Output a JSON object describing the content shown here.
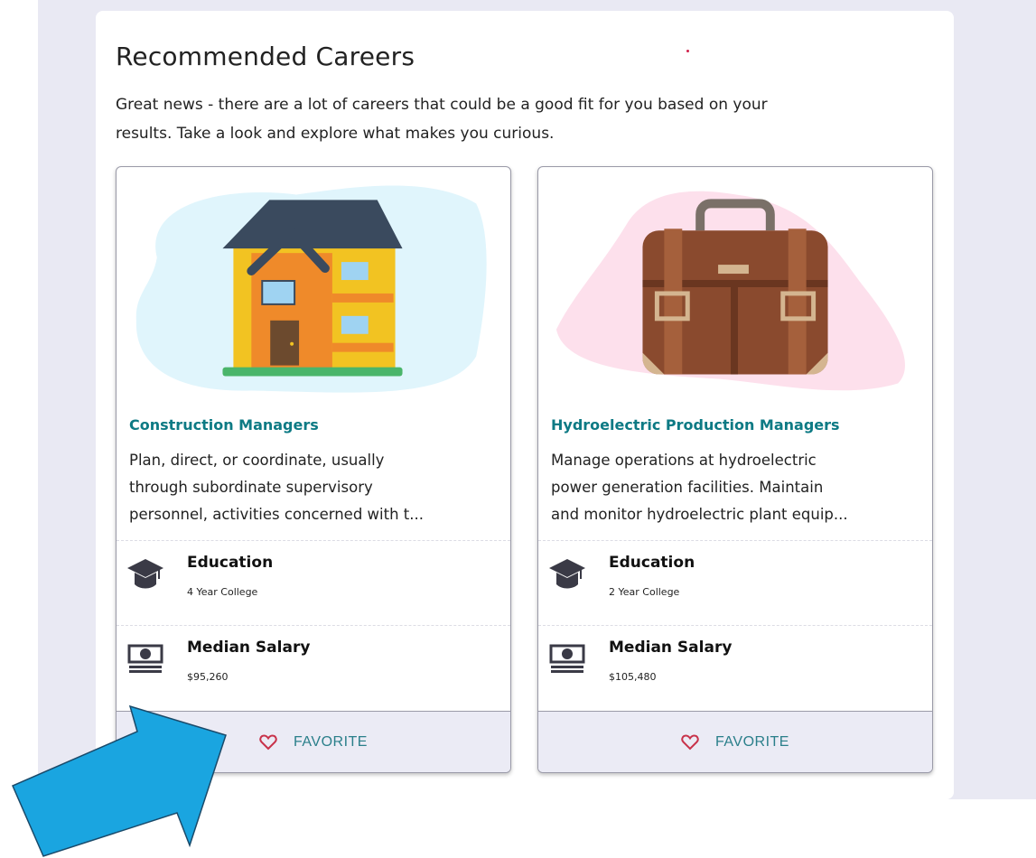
{
  "section": {
    "title": "Recommended Careers",
    "intro_line1": "Great news - there are a lot of careers that could be a good fit for you based on your",
    "intro_line2": "results. Take a look and explore what makes you curious."
  },
  "cards": [
    {
      "name": "Construction Managers",
      "desc_lines": [
        "Plan, direct, or coordinate, usually",
        "through subordinate supervisory",
        "personnel, activities concerned with t..."
      ],
      "education_label": "Education",
      "education_value": "4 Year College",
      "salary_label": "Median Salary",
      "salary_value": "$95,260",
      "favorite_label": "FAVORITE",
      "icon": "house-icon",
      "blob_color": "#e0f5fc"
    },
    {
      "name": "Hydroelectric Production Managers",
      "desc_lines": [
        "Manage operations at hydroelectric",
        "power generation facilities. Maintain",
        "and monitor hydroelectric plant equip..."
      ],
      "education_label": "Education",
      "education_value": "2 Year College",
      "salary_label": "Median Salary",
      "salary_value": "$105,480",
      "favorite_label": "FAVORITE",
      "icon": "briefcase-icon",
      "blob_color": "#fde0ec"
    }
  ],
  "colors": {
    "accent": "#0d7a84",
    "heart": "#c8324a",
    "arrow": "#1aa5e0",
    "background": "#e9e9f3"
  }
}
